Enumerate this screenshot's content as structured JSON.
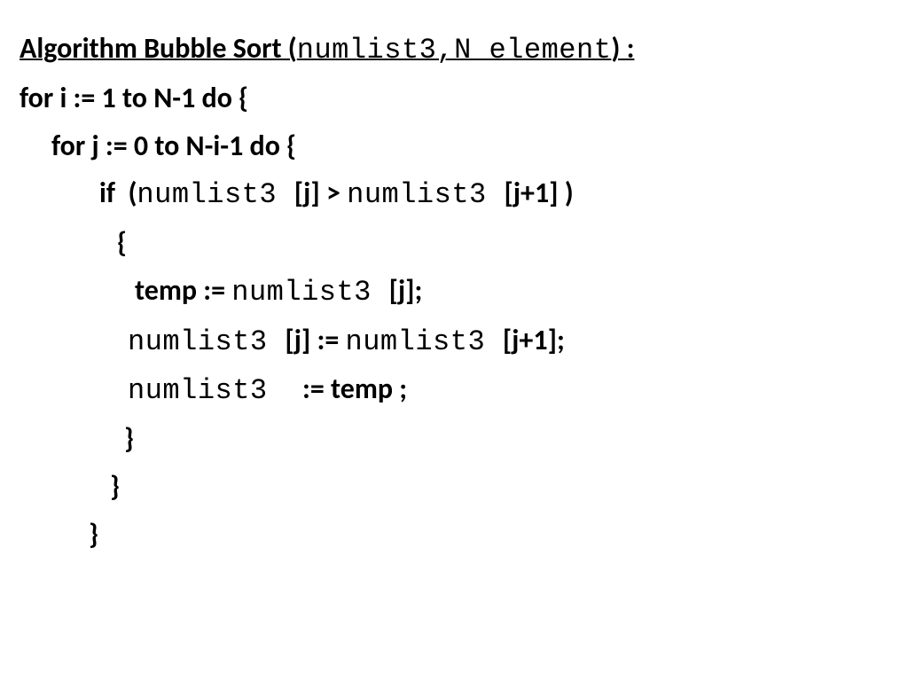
{
  "line1": {
    "a": "Algorithm Bubble Sort (",
    "b": "numlist3,N element",
    "c": ") :"
  },
  "line2": "for i := 1 to N-1 do {",
  "line3": "for j := 0 to N-i-1 do {",
  "line4": {
    "a": "if  (",
    "b": "numlist3 ",
    "c": "[j] > ",
    "d": "numlist3 ",
    "e": "[j+1] )"
  },
  "line5": "{",
  "line6": {
    "a": "temp := ",
    "b": "numlist3 ",
    "c": "[j];"
  },
  "line7": {
    "a": "numlist3 ",
    "b": "[j] := ",
    "c": "numlist3 ",
    "d": "[j+1];"
  },
  "line8": {
    "a": "numlist3  ",
    "b": ":= temp ;"
  },
  "line9": "}",
  "line10": "}",
  "line11": "}"
}
